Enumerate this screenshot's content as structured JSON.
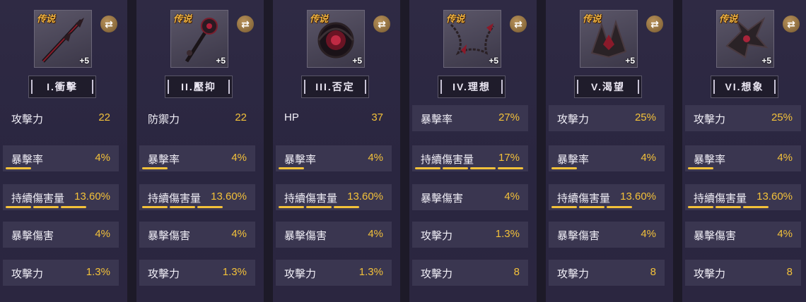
{
  "swap_symbol": "⇄",
  "rarity_label": "传说",
  "accent_color": "#f3c13a",
  "cards": [
    {
      "name": "I.衝擊",
      "level": "+5",
      "main_stat": {
        "label": "攻擊力",
        "value": "22"
      },
      "sub_stats": [
        {
          "label": "暴擊率",
          "value": "4%",
          "rolls": 1
        },
        {
          "label": "持續傷害量",
          "value": "13.60%",
          "rolls": 3
        },
        {
          "label": "暴擊傷害",
          "value": "4%",
          "rolls": 0
        },
        {
          "label": "攻擊力",
          "value": "1.3%",
          "rolls": 0
        }
      ]
    },
    {
      "name": "II.壓抑",
      "level": "+5",
      "main_stat": {
        "label": "防禦力",
        "value": "22"
      },
      "sub_stats": [
        {
          "label": "暴擊率",
          "value": "4%",
          "rolls": 1
        },
        {
          "label": "持續傷害量",
          "value": "13.60%",
          "rolls": 3
        },
        {
          "label": "暴擊傷害",
          "value": "4%",
          "rolls": 0
        },
        {
          "label": "攻擊力",
          "value": "1.3%",
          "rolls": 0
        }
      ]
    },
    {
      "name": "III.否定",
      "level": "+5",
      "main_stat": {
        "label": "HP",
        "value": "37"
      },
      "sub_stats": [
        {
          "label": "暴擊率",
          "value": "4%",
          "rolls": 1
        },
        {
          "label": "持續傷害量",
          "value": "13.60%",
          "rolls": 3
        },
        {
          "label": "暴擊傷害",
          "value": "4%",
          "rolls": 0
        },
        {
          "label": "攻擊力",
          "value": "1.3%",
          "rolls": 0
        }
      ]
    },
    {
      "name": "IV.理想",
      "level": "+5",
      "main_stat": {
        "label": "暴擊率",
        "value": "27%"
      },
      "sub_stats": [
        {
          "label": "持續傷害量",
          "value": "17%",
          "rolls": 4
        },
        {
          "label": "暴擊傷害",
          "value": "4%",
          "rolls": 0
        },
        {
          "label": "攻擊力",
          "value": "1.3%",
          "rolls": 0
        },
        {
          "label": "攻擊力",
          "value": "8",
          "rolls": 0
        }
      ]
    },
    {
      "name": "V.渴望",
      "level": "+5",
      "main_stat": {
        "label": "攻擊力",
        "value": "25%"
      },
      "sub_stats": [
        {
          "label": "暴擊率",
          "value": "4%",
          "rolls": 1
        },
        {
          "label": "持續傷害量",
          "value": "13.60%",
          "rolls": 3
        },
        {
          "label": "暴擊傷害",
          "value": "4%",
          "rolls": 0
        },
        {
          "label": "攻擊力",
          "value": "8",
          "rolls": 0
        }
      ]
    },
    {
      "name": "VI.想象",
      "level": "+5",
      "main_stat": {
        "label": "攻擊力",
        "value": "25%"
      },
      "sub_stats": [
        {
          "label": "暴擊率",
          "value": "4%",
          "rolls": 1
        },
        {
          "label": "持續傷害量",
          "value": "13.60%",
          "rolls": 3
        },
        {
          "label": "暴擊傷害",
          "value": "4%",
          "rolls": 0
        },
        {
          "label": "攻擊力",
          "value": "8",
          "rolls": 0
        }
      ]
    }
  ]
}
